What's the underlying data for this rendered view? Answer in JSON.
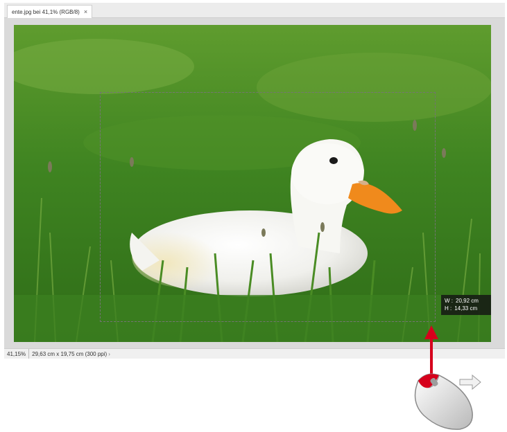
{
  "tab": {
    "title": "ente.jpg bei 41,1% (RGB/8)",
    "close_glyph": "×"
  },
  "canvas": {
    "image_subject": "white duck in grass",
    "selection": "rectangular marquee"
  },
  "readout": {
    "w_label": "W :",
    "w_value": "20,92 cm",
    "h_label": "H :",
    "h_value": "14,33 cm"
  },
  "statusbar": {
    "zoom": "41,15%",
    "doc_size": "29,63 cm x 19,75 cm (300 ppi)",
    "arrow_glyph": "›"
  },
  "annotation": {
    "arrow_color": "#d6001c",
    "icon": "mouse-icon",
    "drag_direction": "right"
  },
  "colors": {
    "grass": "#3f8a22",
    "duck": "#f4f4f0",
    "beak": "#f08a1c"
  }
}
